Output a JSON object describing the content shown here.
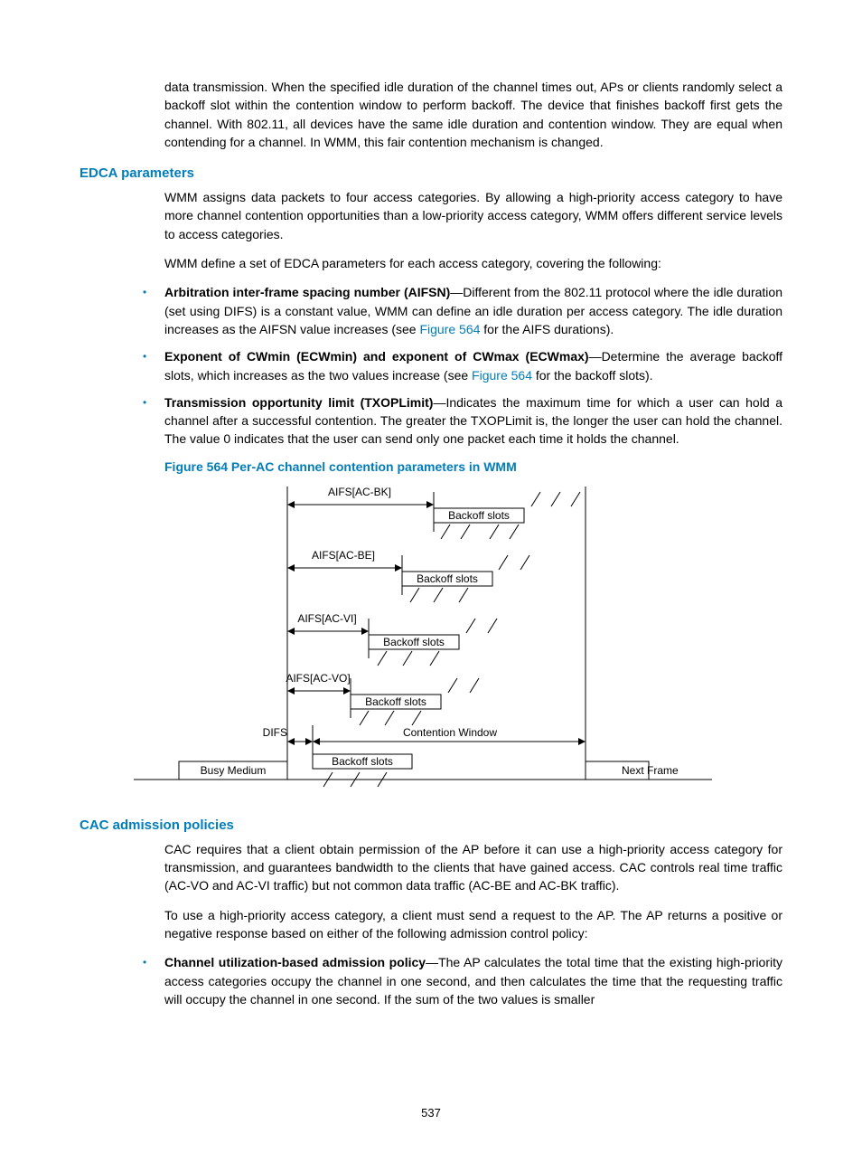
{
  "intro_paragraph": "data transmission. When the specified idle duration of the channel times out, APs or clients randomly select a backoff slot within the contention window to perform backoff. The device that finishes backoff first gets the channel. With 802.11, all devices have the same idle duration and contention window. They are equal when contending for a channel. In WMM, this fair contention mechanism is changed.",
  "section1": {
    "heading": "EDCA parameters",
    "p1": "WMM assigns data packets to four access categories. By allowing a high-priority access category to have more channel contention opportunities than a low-priority access category, WMM offers different service levels to access categories.",
    "p2": "WMM define a set of EDCA parameters for each access category, covering the following:",
    "bullets": [
      {
        "bold": "Arbitration inter-frame spacing number (AIFSN)",
        "pre": "—Different from the 802.11 protocol where the idle duration (set using DIFS) is a constant value, WMM can define an idle duration per access category. The idle duration increases as the AIFSN value increases (see ",
        "ref": "Figure 564",
        "post": " for the AIFS durations)."
      },
      {
        "bold": "Exponent of CWmin (ECWmin) and exponent of CWmax (ECWmax)",
        "pre": "—Determine the average backoff slots, which increases as the two values increase (see ",
        "ref": "Figure 564",
        "post": " for the backoff slots)."
      },
      {
        "bold": "Transmission opportunity limit (TXOPLimit)",
        "pre": "—Indicates the maximum time for which a user can hold a channel after a successful contention. The greater the TXOPLimit is, the longer the user can hold the channel. The value 0 indicates that the user can send only one packet each time it holds the channel.",
        "ref": "",
        "post": ""
      }
    ],
    "figure_caption": "Figure 564 Per-AC channel contention parameters in WMM"
  },
  "diagram": {
    "aifs_labels": [
      "AIFS[AC-BK]",
      "AIFS[AC-BE]",
      "AIFS[AC-VI]",
      "AIFS[AC-VO]"
    ],
    "backoff_label": "Backoff slots",
    "difs_label": "DIFS",
    "contention_label": "Contention Window",
    "busy_label": "Busy Medium",
    "next_label": "Next Frame"
  },
  "section2": {
    "heading": "CAC admission policies",
    "p1": "CAC requires that a client obtain permission of the AP before it can use a high-priority access category for transmission, and guarantees bandwidth to the clients that have gained access. CAC controls real time traffic (AC-VO and AC-VI traffic) but not common data traffic (AC-BE and AC-BK traffic).",
    "p2": "To use a high-priority access category, a client must send a request to the AP. The AP returns a positive or negative response based on either of the following admission control policy:",
    "bullets": [
      {
        "bold": "Channel utilization-based admission policy",
        "text": "—The AP calculates the total time that the existing high-priority access categories occupy the channel in one second, and then calculates the time that the requesting traffic will occupy the channel in one second. If the sum of the two values is smaller"
      }
    ]
  },
  "page_number": "537"
}
